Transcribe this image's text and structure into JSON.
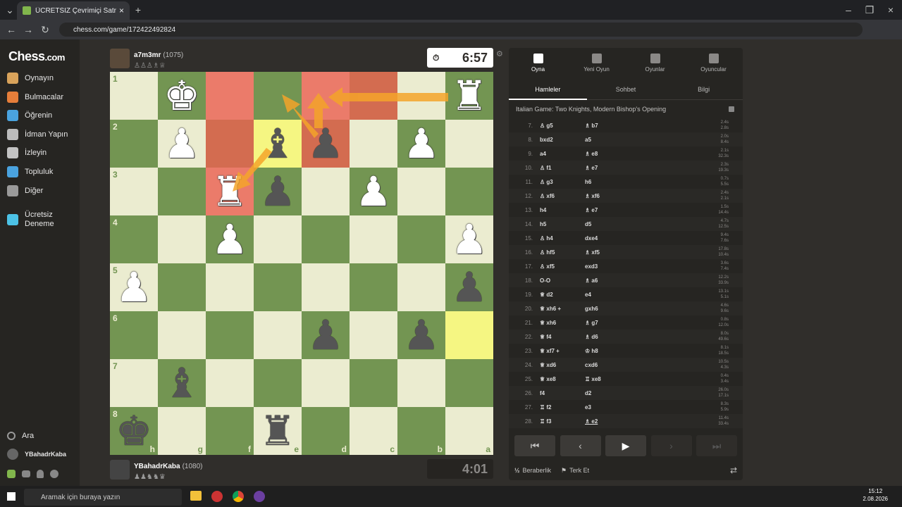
{
  "browser": {
    "tab_title": "ÜCRETSİZ Çevrimiçi Satranç Oyn",
    "url": "chess.com/game/172422492824"
  },
  "sidebar": {
    "logo_main": "Chess",
    "logo_suffix": ".com",
    "items": [
      {
        "label": "Oynayın",
        "color": "#d9a35b"
      },
      {
        "label": "Bulmacalar",
        "color": "#e67e3a"
      },
      {
        "label": "Öğrenin",
        "color": "#4aa3df"
      },
      {
        "label": "İdman Yapın",
        "color": "#bcbcbc"
      },
      {
        "label": "İzleyin",
        "color": "#c3c3c3"
      },
      {
        "label": "Topluluk",
        "color": "#4aa3df"
      },
      {
        "label": "Diğer",
        "color": "#9a9a9a"
      },
      {
        "label": "Ücretsiz Deneme",
        "color": "#4cc2e6"
      }
    ],
    "search_label": "Ara",
    "username": "YBahadrKaba"
  },
  "top_player": {
    "name": "a7m3mr",
    "rating": "(1075)",
    "clock": "6:57"
  },
  "bottom_player": {
    "name": "YBahadrKaba",
    "rating": "(1080)",
    "clock": "4:01"
  },
  "board": {
    "ranks": [
      "1",
      "2",
      "3",
      "4",
      "5",
      "6",
      "7",
      "8"
    ],
    "files": [
      "h",
      "g",
      "f",
      "e",
      "d",
      "c",
      "b",
      "a"
    ],
    "squares": [
      [
        "",
        "wK",
        "",
        "",
        "",
        "",
        "",
        "wR"
      ],
      [
        "",
        "wP",
        "",
        "bB",
        "bP",
        "",
        "wP",
        ""
      ],
      [
        "",
        "",
        "wR",
        "bP",
        "",
        "wP",
        "",
        ""
      ],
      [
        "",
        "",
        "wP",
        "",
        "",
        "",
        "",
        "wP"
      ],
      [
        "wP",
        "",
        "",
        "",
        "",
        "",
        "",
        "bP"
      ],
      [
        "",
        "",
        "",
        "",
        "bP",
        "",
        "bP",
        ""
      ],
      [
        "",
        "bB",
        "",
        "",
        "",
        "",
        "",
        ""
      ],
      [
        "bK",
        "",
        "",
        "bR",
        "",
        "",
        "",
        ""
      ]
    ],
    "highlights": {
      "red": [
        "0-2",
        "0-4",
        "0-5",
        "1-2",
        "1-4",
        "2-2"
      ],
      "yellow": [
        "1-3",
        "5-7"
      ]
    }
  },
  "panel": {
    "tabs": [
      "Oyna",
      "Yeni Oyun",
      "Oyunlar",
      "Oyuncular"
    ],
    "subtabs": [
      "Hamleler",
      "Sohbet",
      "Bilgi"
    ],
    "opening": "Italian Game: Two Knights, Modern Bishop's Opening",
    "moves": [
      {
        "n": "7.",
        "w": "♙ g5",
        "b": "♗ b7",
        "t1": "2.4s",
        "t2": "2.8s"
      },
      {
        "n": "8.",
        "w": "bxd2",
        "b": "a5",
        "t1": "2.0s",
        "t2": "8.4s"
      },
      {
        "n": "9.",
        "w": "a4",
        "b": "♗ e8",
        "t1": "2.1s",
        "t2": "32.3s"
      },
      {
        "n": "10.",
        "w": "♙ f1",
        "b": "♗ e7",
        "t1": "2.3s",
        "t2": "19.3s"
      },
      {
        "n": "11.",
        "w": "♙ g3",
        "b": "h6",
        "t1": "0.7s",
        "t2": "5.5s"
      },
      {
        "n": "12.",
        "w": "♙ xf6",
        "b": "♗ xf6",
        "t1": "2.4s",
        "t2": "2.1s"
      },
      {
        "n": "13.",
        "w": "h4",
        "b": "♗ e7",
        "t1": "1.5s",
        "t2": "14.4s"
      },
      {
        "n": "14.",
        "w": "h5",
        "b": "d5",
        "t1": "4.7s",
        "t2": "12.5s"
      },
      {
        "n": "15.",
        "w": "♙ h4",
        "b": "dxe4",
        "t1": "9.4s",
        "t2": "7.6s"
      },
      {
        "n": "16.",
        "w": "♙ hf5",
        "b": "♗ xf5",
        "t1": "17.8s",
        "t2": "10.4s"
      },
      {
        "n": "17.",
        "w": "♙ xf5",
        "b": "exd3",
        "t1": "3.6s",
        "t2": "7.4s"
      },
      {
        "n": "18.",
        "w": "O-O",
        "b": "♗ a6",
        "t1": "12.2s",
        "t2": "33.9s"
      },
      {
        "n": "19.",
        "w": "♕ d2",
        "b": "e4",
        "t1": "13.1s",
        "t2": "5.1s"
      },
      {
        "n": "20.",
        "w": "♕ xh6 +",
        "b": "gxh6",
        "t1": "4.6s",
        "t2": "9.6s"
      },
      {
        "n": "21.",
        "w": "♕ xh6",
        "b": "♗ g7",
        "t1": "0.8s",
        "t2": "12.0s"
      },
      {
        "n": "22.",
        "w": "♕ f4",
        "b": "♗ d6",
        "t1": "8.0s",
        "t2": "49.6s"
      },
      {
        "n": "23.",
        "w": "♕ xf7 +",
        "b": "♔ h8",
        "t1": "8.1s",
        "t2": "18.5s"
      },
      {
        "n": "24.",
        "w": "♕ xd6",
        "b": "cxd6",
        "t1": "10.5s",
        "t2": "4.3s"
      },
      {
        "n": "25.",
        "w": "♕ xe8",
        "b": "♖ xe8",
        "t1": "0.4s",
        "t2": "3.4s"
      },
      {
        "n": "26.",
        "w": "f4",
        "b": "d2",
        "t1": "26.0s",
        "t2": "17.1s"
      },
      {
        "n": "27.",
        "w": "♖ f2",
        "b": "e3",
        "t1": "8.3s",
        "t2": "5.9s"
      },
      {
        "n": "28.",
        "w": "♖ f3",
        "b": "♗ e2",
        "t1": "11.4s",
        "t2": "33.4s"
      }
    ],
    "draw_label": "Beraberlik",
    "resign_label": "Terk Et",
    "half": "½"
  },
  "taskbar": {
    "search_placeholder": "Aramak için buraya yazın",
    "time": "15:12",
    "date": "2.08.2026"
  }
}
